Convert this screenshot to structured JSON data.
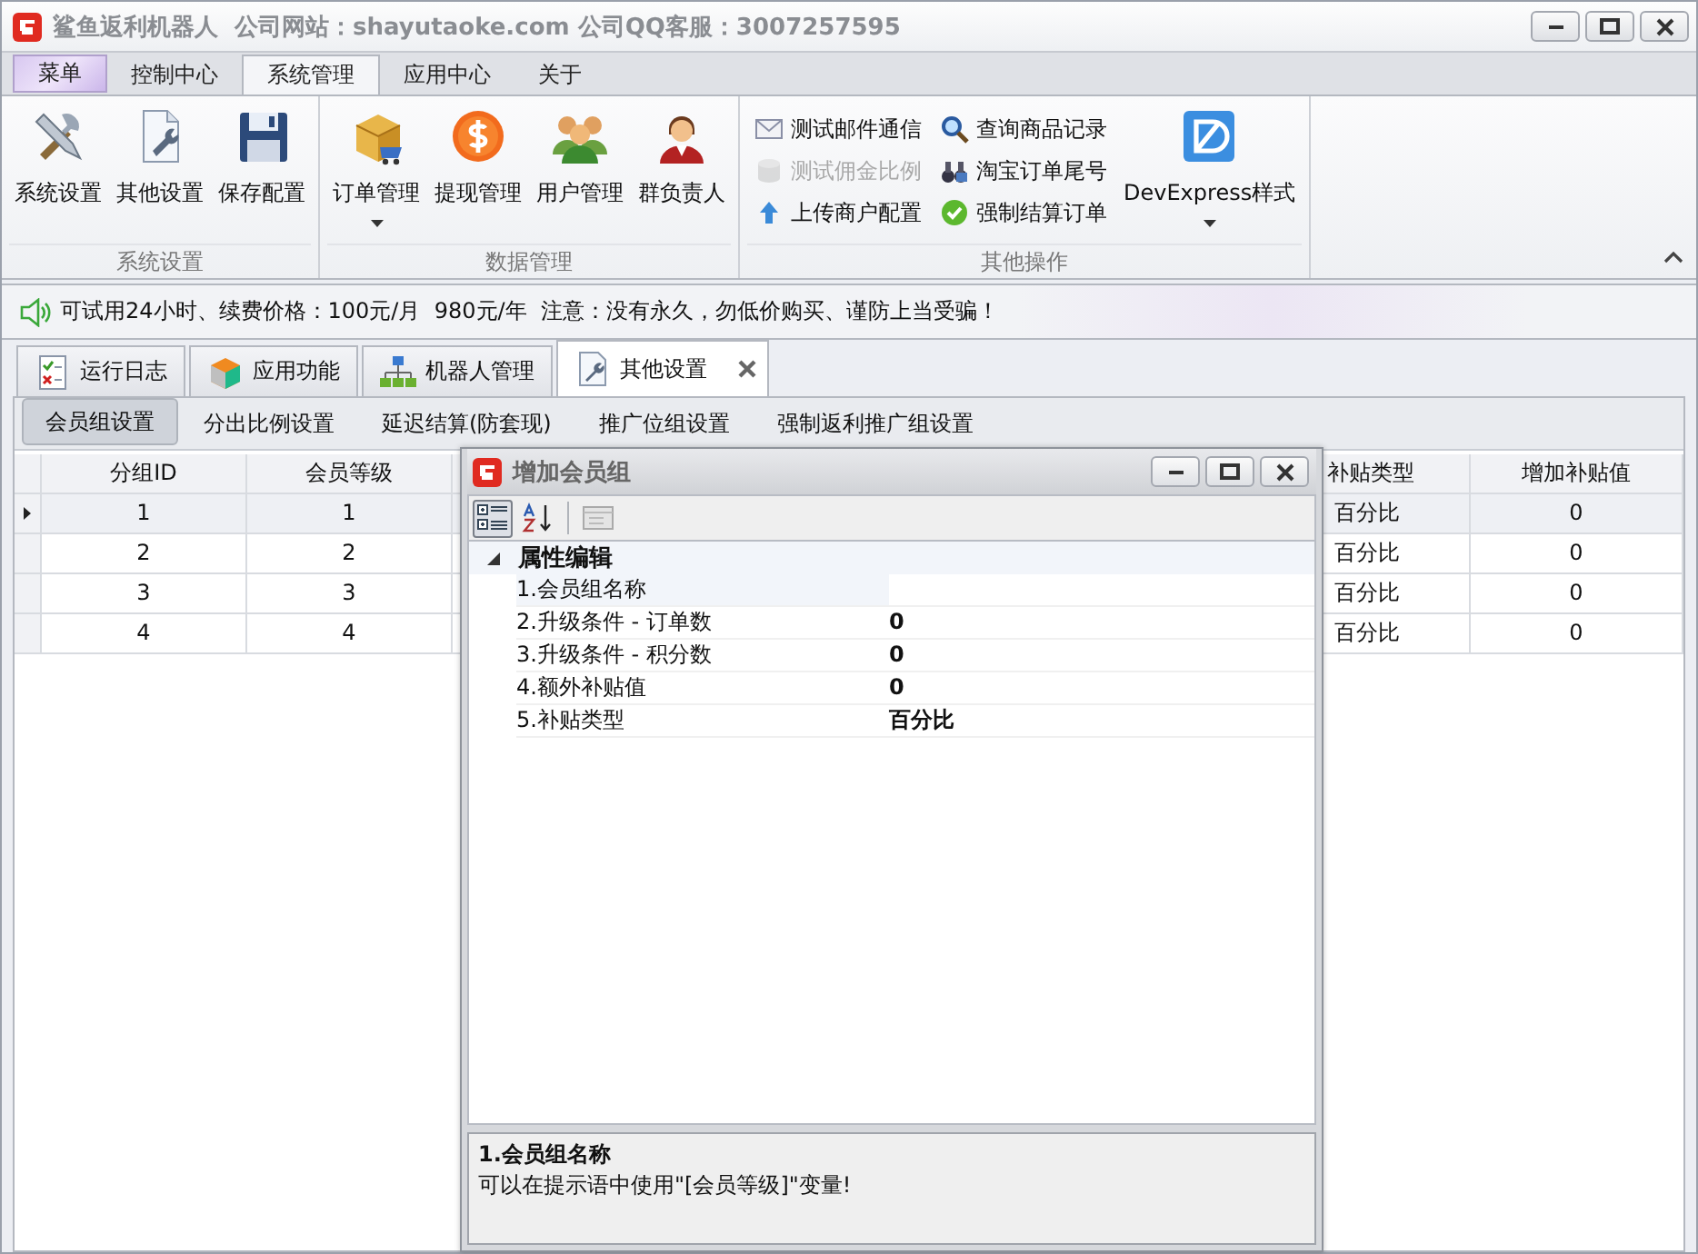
{
  "window": {
    "title": "鲨鱼返利机器人  公司网站：shayutaoke.com 公司QQ客服：3007257595"
  },
  "ribbon_tabs": [
    {
      "label": "菜单",
      "kind": "app",
      "selected": false
    },
    {
      "label": "控制中心",
      "kind": "tab",
      "selected": false
    },
    {
      "label": "系统管理",
      "kind": "tab",
      "selected": true
    },
    {
      "label": "应用中心",
      "kind": "tab",
      "selected": false
    },
    {
      "label": "关于",
      "kind": "tab",
      "selected": false
    }
  ],
  "ribbon_groups": [
    {
      "caption": "系统设置",
      "items": [
        {
          "label": "系统设置",
          "kind": "large",
          "dropdown": false
        },
        {
          "label": "其他设置",
          "kind": "large",
          "dropdown": false
        },
        {
          "label": "保存配置",
          "kind": "large",
          "dropdown": false
        }
      ]
    },
    {
      "caption": "数据管理",
      "items": [
        {
          "label": "订单管理",
          "kind": "large",
          "dropdown": true
        },
        {
          "label": "提现管理",
          "kind": "large",
          "dropdown": false
        },
        {
          "label": "用户管理",
          "kind": "large",
          "dropdown": false
        },
        {
          "label": "群负责人",
          "kind": "large",
          "dropdown": false
        }
      ]
    },
    {
      "caption": "其他操作",
      "items": [
        {
          "label": "测试邮件通信",
          "kind": "small",
          "disabled": false
        },
        {
          "label": "测试佣金比例",
          "kind": "small",
          "disabled": true
        },
        {
          "label": "上传商户配置",
          "kind": "small",
          "disabled": false
        },
        {
          "label": "查询商品记录",
          "kind": "small",
          "disabled": false
        },
        {
          "label": "淘宝订单尾号",
          "kind": "small",
          "disabled": false
        },
        {
          "label": "强制结算订单",
          "kind": "small",
          "disabled": false
        },
        {
          "label": "DevExpress样式",
          "kind": "large",
          "dropdown": true
        }
      ]
    }
  ],
  "notice": "可试用24小时、续费价格：100元/月  980元/年  注意：没有永久，勿低价购买、谨防上当受骗！",
  "doc_tabs": [
    {
      "label": "运行日志",
      "selected": false,
      "closable": false
    },
    {
      "label": "应用功能",
      "selected": false,
      "closable": false
    },
    {
      "label": "机器人管理",
      "selected": false,
      "closable": false
    },
    {
      "label": "其他设置",
      "selected": true,
      "closable": true
    }
  ],
  "sub_tabs": [
    {
      "label": "会员组设置",
      "selected": true
    },
    {
      "label": "分出比例设置",
      "selected": false
    },
    {
      "label": "延迟结算(防套现)",
      "selected": false
    },
    {
      "label": "推广位组设置",
      "selected": false
    },
    {
      "label": "强制返利推广组设置",
      "selected": false
    }
  ],
  "table": {
    "columns": [
      "分组ID",
      "会员等级",
      "补贴类型",
      "增加补贴值"
    ],
    "rows": [
      {
        "cells": [
          "1",
          "1",
          "百分比",
          "0"
        ],
        "selected": true
      },
      {
        "cells": [
          "2",
          "2",
          "百分比",
          "0"
        ],
        "selected": false
      },
      {
        "cells": [
          "3",
          "3",
          "百分比",
          "0"
        ],
        "selected": false
      },
      {
        "cells": [
          "4",
          "4",
          "百分比",
          "0"
        ],
        "selected": false
      }
    ]
  },
  "dialog": {
    "title": "增加会员组",
    "toolbar": [
      {
        "kind": "categorized",
        "selected": true
      },
      {
        "kind": "alphabetical",
        "selected": false
      },
      {
        "kind": "pages",
        "selected": false
      }
    ],
    "category": {
      "label": "属性编辑",
      "expanded": true
    },
    "properties": [
      {
        "name": "1.会员组名称",
        "selected": true
      },
      {
        "name": "2.升级条件 - 订单数",
        "value": "0",
        "selected": false
      },
      {
        "name": "3.升级条件 - 积分数",
        "value": "0",
        "selected": false
      },
      {
        "name": "4.额外补贴值",
        "value": "0",
        "selected": false
      },
      {
        "name": "5.补贴类型",
        "value": "百分比",
        "selected": false
      }
    ],
    "description": {
      "title": "1.会员组名称",
      "text": "可以在提示语中使用\"[会员等级]\"变量!"
    }
  }
}
